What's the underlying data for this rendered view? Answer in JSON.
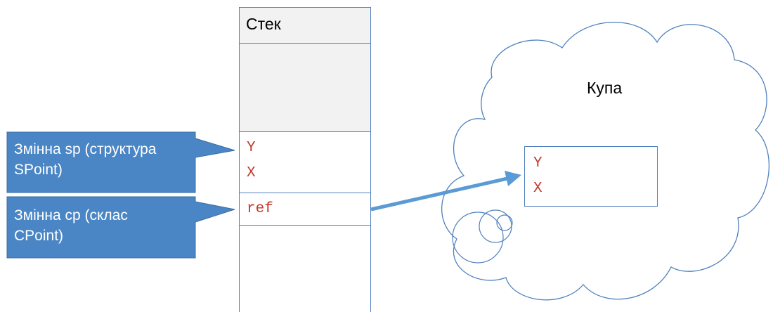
{
  "stack": {
    "title": "Стек",
    "struct_fields": [
      "Y",
      "X"
    ],
    "ref_label": "ref"
  },
  "heap": {
    "title": "Купа",
    "object_fields": [
      "Y",
      "X"
    ]
  },
  "callouts": [
    {
      "line1": "Змінна sp (структура",
      "line2": "SPoint)"
    },
    {
      "line1": "Змінна cp (склас",
      "line2": "CPoint)"
    }
  ],
  "colors": {
    "callout_fill": "#4a86c5",
    "border": "#4f81bd",
    "code_text": "#c0392b",
    "arrow": "#5b9bd5"
  }
}
